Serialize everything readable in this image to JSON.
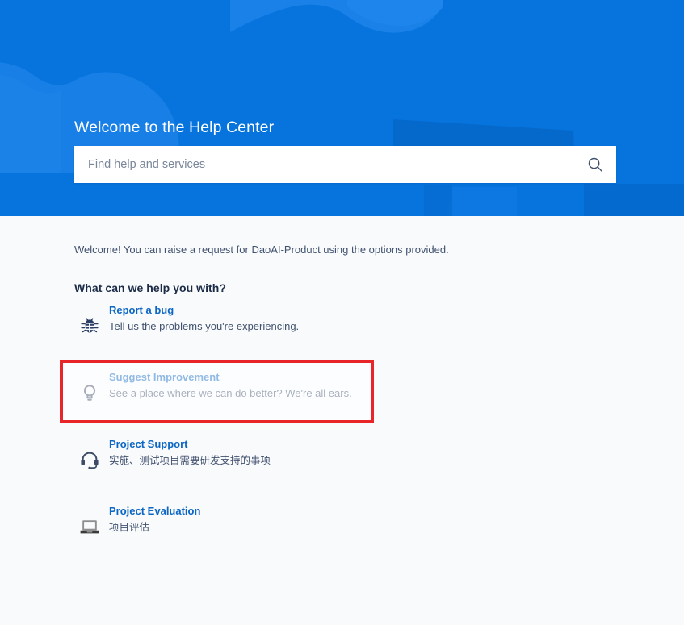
{
  "header": {
    "title": "Welcome to the Help Center",
    "background_color": "#0774de",
    "search": {
      "placeholder": "Find help and services",
      "value": "",
      "icon": "search-icon"
    }
  },
  "main": {
    "intro": "Welcome! You can raise a request for DaoAI-Product using the options provided.",
    "section_heading": "What can we help you with?",
    "link_color": "#0c66c4",
    "requests": [
      {
        "icon": "bug-icon",
        "title": "Report a bug",
        "description": "Tell us the problems you're experiencing."
      },
      {
        "icon": "lightbulb-icon",
        "title": "Suggest Improvement",
        "description": "See a place where we can do better? We're all ears."
      },
      {
        "icon": "headset-icon",
        "title": "Project Support",
        "description": "实施、测试项目需要研发支持的事项"
      },
      {
        "icon": "laptop-icon",
        "title": "Project Evaluation",
        "description": "项目评估"
      }
    ]
  },
  "annotation": {
    "target": "Suggest Improvement",
    "color": "#e8262a"
  }
}
